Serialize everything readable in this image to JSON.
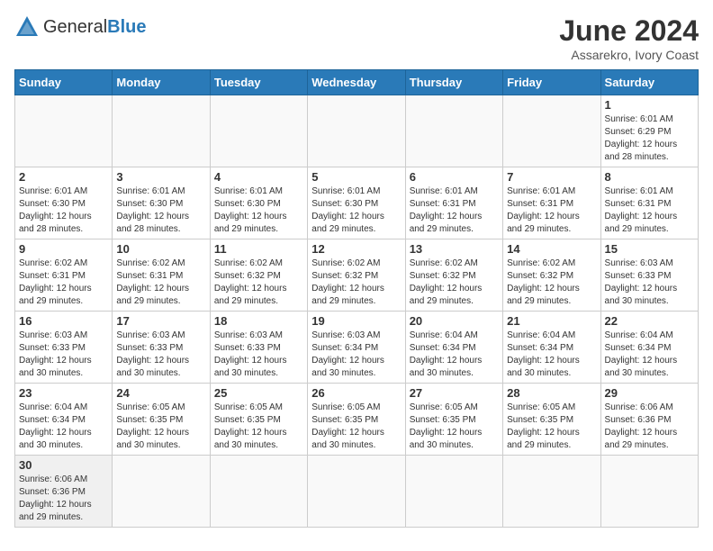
{
  "header": {
    "logo_general": "General",
    "logo_blue": "Blue",
    "title": "June 2024",
    "subtitle": "Assarekro, Ivory Coast"
  },
  "days_of_week": [
    "Sunday",
    "Monday",
    "Tuesday",
    "Wednesday",
    "Thursday",
    "Friday",
    "Saturday"
  ],
  "weeks": [
    [
      {
        "day": "",
        "info": ""
      },
      {
        "day": "",
        "info": ""
      },
      {
        "day": "",
        "info": ""
      },
      {
        "day": "",
        "info": ""
      },
      {
        "day": "",
        "info": ""
      },
      {
        "day": "",
        "info": ""
      },
      {
        "day": "1",
        "info": "Sunrise: 6:01 AM\nSunset: 6:29 PM\nDaylight: 12 hours\nand 28 minutes."
      }
    ],
    [
      {
        "day": "2",
        "info": "Sunrise: 6:01 AM\nSunset: 6:30 PM\nDaylight: 12 hours\nand 28 minutes."
      },
      {
        "day": "3",
        "info": "Sunrise: 6:01 AM\nSunset: 6:30 PM\nDaylight: 12 hours\nand 28 minutes."
      },
      {
        "day": "4",
        "info": "Sunrise: 6:01 AM\nSunset: 6:30 PM\nDaylight: 12 hours\nand 29 minutes."
      },
      {
        "day": "5",
        "info": "Sunrise: 6:01 AM\nSunset: 6:30 PM\nDaylight: 12 hours\nand 29 minutes."
      },
      {
        "day": "6",
        "info": "Sunrise: 6:01 AM\nSunset: 6:31 PM\nDaylight: 12 hours\nand 29 minutes."
      },
      {
        "day": "7",
        "info": "Sunrise: 6:01 AM\nSunset: 6:31 PM\nDaylight: 12 hours\nand 29 minutes."
      },
      {
        "day": "8",
        "info": "Sunrise: 6:01 AM\nSunset: 6:31 PM\nDaylight: 12 hours\nand 29 minutes."
      }
    ],
    [
      {
        "day": "9",
        "info": "Sunrise: 6:02 AM\nSunset: 6:31 PM\nDaylight: 12 hours\nand 29 minutes."
      },
      {
        "day": "10",
        "info": "Sunrise: 6:02 AM\nSunset: 6:31 PM\nDaylight: 12 hours\nand 29 minutes."
      },
      {
        "day": "11",
        "info": "Sunrise: 6:02 AM\nSunset: 6:32 PM\nDaylight: 12 hours\nand 29 minutes."
      },
      {
        "day": "12",
        "info": "Sunrise: 6:02 AM\nSunset: 6:32 PM\nDaylight: 12 hours\nand 29 minutes."
      },
      {
        "day": "13",
        "info": "Sunrise: 6:02 AM\nSunset: 6:32 PM\nDaylight: 12 hours\nand 29 minutes."
      },
      {
        "day": "14",
        "info": "Sunrise: 6:02 AM\nSunset: 6:32 PM\nDaylight: 12 hours\nand 29 minutes."
      },
      {
        "day": "15",
        "info": "Sunrise: 6:03 AM\nSunset: 6:33 PM\nDaylight: 12 hours\nand 30 minutes."
      }
    ],
    [
      {
        "day": "16",
        "info": "Sunrise: 6:03 AM\nSunset: 6:33 PM\nDaylight: 12 hours\nand 30 minutes."
      },
      {
        "day": "17",
        "info": "Sunrise: 6:03 AM\nSunset: 6:33 PM\nDaylight: 12 hours\nand 30 minutes."
      },
      {
        "day": "18",
        "info": "Sunrise: 6:03 AM\nSunset: 6:33 PM\nDaylight: 12 hours\nand 30 minutes."
      },
      {
        "day": "19",
        "info": "Sunrise: 6:03 AM\nSunset: 6:34 PM\nDaylight: 12 hours\nand 30 minutes."
      },
      {
        "day": "20",
        "info": "Sunrise: 6:04 AM\nSunset: 6:34 PM\nDaylight: 12 hours\nand 30 minutes."
      },
      {
        "day": "21",
        "info": "Sunrise: 6:04 AM\nSunset: 6:34 PM\nDaylight: 12 hours\nand 30 minutes."
      },
      {
        "day": "22",
        "info": "Sunrise: 6:04 AM\nSunset: 6:34 PM\nDaylight: 12 hours\nand 30 minutes."
      }
    ],
    [
      {
        "day": "23",
        "info": "Sunrise: 6:04 AM\nSunset: 6:34 PM\nDaylight: 12 hours\nand 30 minutes."
      },
      {
        "day": "24",
        "info": "Sunrise: 6:05 AM\nSunset: 6:35 PM\nDaylight: 12 hours\nand 30 minutes."
      },
      {
        "day": "25",
        "info": "Sunrise: 6:05 AM\nSunset: 6:35 PM\nDaylight: 12 hours\nand 30 minutes."
      },
      {
        "day": "26",
        "info": "Sunrise: 6:05 AM\nSunset: 6:35 PM\nDaylight: 12 hours\nand 30 minutes."
      },
      {
        "day": "27",
        "info": "Sunrise: 6:05 AM\nSunset: 6:35 PM\nDaylight: 12 hours\nand 30 minutes."
      },
      {
        "day": "28",
        "info": "Sunrise: 6:05 AM\nSunset: 6:35 PM\nDaylight: 12 hours\nand 29 minutes."
      },
      {
        "day": "29",
        "info": "Sunrise: 6:06 AM\nSunset: 6:36 PM\nDaylight: 12 hours\nand 29 minutes."
      }
    ],
    [
      {
        "day": "30",
        "info": "Sunrise: 6:06 AM\nSunset: 6:36 PM\nDaylight: 12 hours\nand 29 minutes."
      },
      {
        "day": "",
        "info": ""
      },
      {
        "day": "",
        "info": ""
      },
      {
        "day": "",
        "info": ""
      },
      {
        "day": "",
        "info": ""
      },
      {
        "day": "",
        "info": ""
      },
      {
        "day": "",
        "info": ""
      }
    ]
  ]
}
